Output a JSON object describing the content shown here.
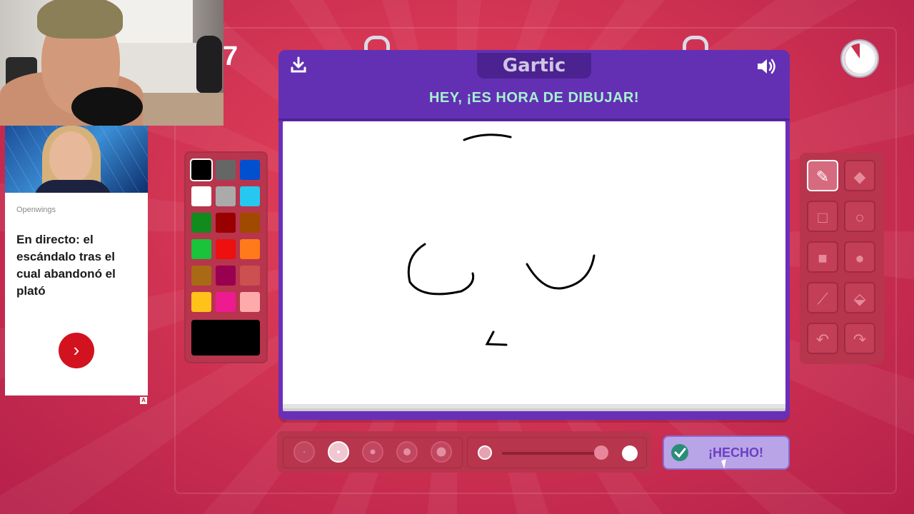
{
  "score": "7",
  "game": {
    "logo": "Gartic",
    "heading": "HEY, ¡ES HORA DE DIBUJAR!",
    "download_icon": "download-icon",
    "sound_icon": "speaker-icon",
    "done_label": "¡HECHO!",
    "current_color": "#000000",
    "selected_tool": "pencil",
    "selected_brush_size": 2,
    "opacity_level": 0.95
  },
  "palette": {
    "colors": [
      "#000000",
      "#666666",
      "#0050d0",
      "#ffffff",
      "#aaaaaa",
      "#27c8f0",
      "#118a1e",
      "#990000",
      "#a04a00",
      "#19c33a",
      "#ee0f0f",
      "#ff7a1a",
      "#a86a14",
      "#990050",
      "#cc5050",
      "#ffc21a",
      "#ee1a8f",
      "#ffaaaa"
    ]
  },
  "tools": [
    {
      "name": "pencil-tool",
      "icon": "✎"
    },
    {
      "name": "eraser-tool",
      "icon": "◆"
    },
    {
      "name": "rectangle-outline-tool",
      "icon": "□"
    },
    {
      "name": "ellipse-outline-tool",
      "icon": "○"
    },
    {
      "name": "rectangle-fill-tool",
      "icon": "■"
    },
    {
      "name": "ellipse-fill-tool",
      "icon": "●"
    },
    {
      "name": "line-tool",
      "icon": "⟋"
    },
    {
      "name": "fill-bucket-tool",
      "icon": "⬙"
    },
    {
      "name": "undo-tool",
      "icon": "↶"
    },
    {
      "name": "redo-tool",
      "icon": "↷"
    }
  ],
  "ad": {
    "source": "Openwings",
    "title": "En directo: el escándalo tras el cual abandonó el plató",
    "cta_icon": "›",
    "badge": "A"
  }
}
